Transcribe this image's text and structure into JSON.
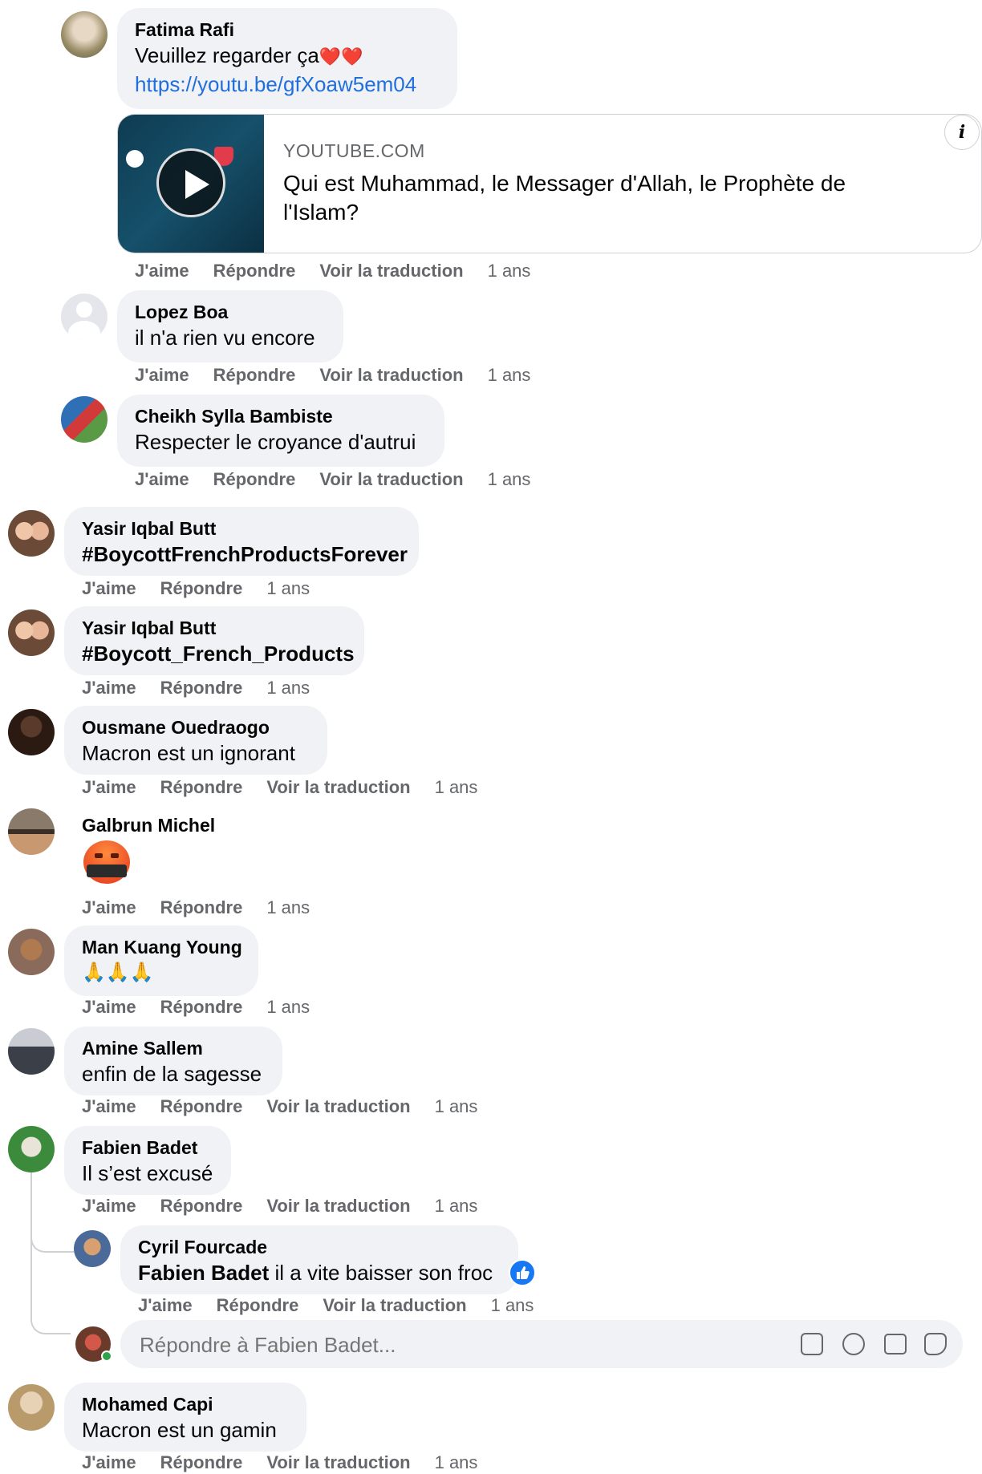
{
  "actions": {
    "like": "J'aime",
    "reply": "Répondre",
    "translate": "Voir la traduction",
    "time": "1 ans"
  },
  "comments": [
    {
      "author": "Fatima Rafi",
      "text": "Veuillez regarder ça",
      "link": "https://youtu.be/gfXoaw5em04"
    },
    {
      "author": "Lopez Boa",
      "text": "il n'a rien vu encore"
    },
    {
      "author": "Cheikh Sylla Bambiste",
      "text": "Respecter le croyance d'autrui"
    },
    {
      "author": "Yasir Iqbal Butt",
      "text": "#BoycottFrenchProductsForever"
    },
    {
      "author": "Yasir Iqbal Butt",
      "text": "#Boycott_French_Products"
    },
    {
      "author": "Ousmane Ouedraogo",
      "text": "Macron est un ignorant"
    },
    {
      "author": "Galbrun Michel",
      "text": "🤬"
    },
    {
      "author": "Man Kuang Young",
      "text": "🙏🙏🙏"
    },
    {
      "author": "Amine Sallem",
      "text": "enfin de la sagesse"
    },
    {
      "author": "Fabien Badet",
      "text": "Il s’est excusé"
    },
    {
      "author": "Cyril Fourcade",
      "mention": "Fabien Badet",
      "text": "il a vite baisser son froc"
    },
    {
      "author": "Mohamed Capi",
      "text": "Macron est un gamin"
    }
  ],
  "preview": {
    "domain": "YOUTUBE.COM",
    "title_line1": "Qui est Muhammad, le Messager d'Allah, le Prophète de",
    "title_line2": "l'Islam?",
    "info": "i"
  },
  "reply_box": {
    "placeholder": "Répondre à Fabien Badet..."
  },
  "colors": {
    "bubble": "#f0f2f5",
    "link": "#216fdb",
    "meta": "#65676b",
    "like": "#1877f2"
  }
}
